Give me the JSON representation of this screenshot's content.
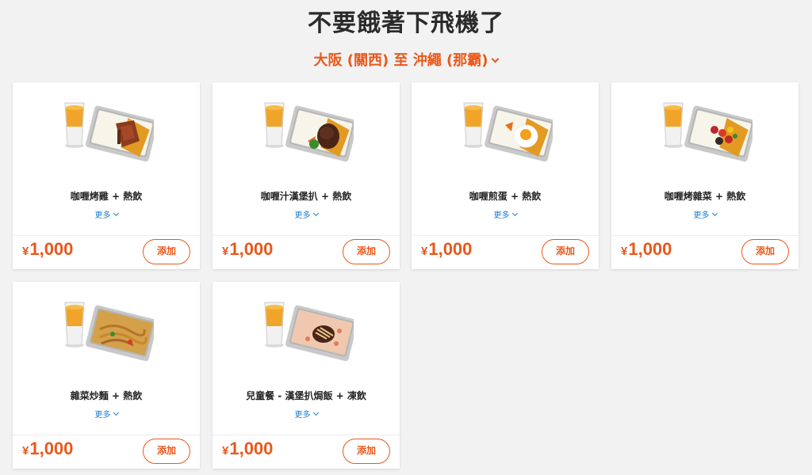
{
  "header": {
    "title": "不要餓著下飛機了",
    "route": "大阪 (關西) 至 沖繩 (那霸)"
  },
  "menu": [
    {
      "name": "咖喱烤雞 + 熱飲",
      "more": "更多",
      "currency": "¥",
      "price": "1,000",
      "add": "添加",
      "topping": "chicken"
    },
    {
      "name": "咖喱汁漢堡扒 + 熱飲",
      "more": "更多",
      "currency": "¥",
      "price": "1,000",
      "add": "添加",
      "topping": "hamburg"
    },
    {
      "name": "咖喱煎蛋 + 熱飲",
      "more": "更多",
      "currency": "¥",
      "price": "1,000",
      "add": "添加",
      "topping": "egg"
    },
    {
      "name": "咖喱烤雜菜 + 熱飲",
      "more": "更多",
      "currency": "¥",
      "price": "1,000",
      "add": "添加",
      "topping": "veggie"
    },
    {
      "name": "雜菜炒麵 + 熱飲",
      "more": "更多",
      "currency": "¥",
      "price": "1,000",
      "add": "添加",
      "topping": "noodle"
    },
    {
      "name": "兒童餐 - 漢堡扒焗飯 + 凍飲",
      "more": "更多",
      "currency": "¥",
      "price": "1,000",
      "add": "添加",
      "topping": "kids"
    }
  ],
  "colors": {
    "accent": "#e9581a",
    "link": "#1a7fd1",
    "background": "#f2f2f2"
  }
}
